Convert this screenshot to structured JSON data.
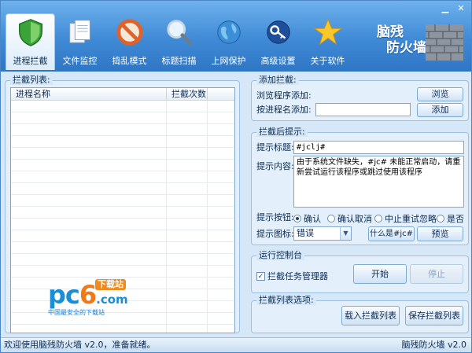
{
  "toolbar": {
    "items": [
      {
        "label": "进程拦截",
        "icon": "shield-icon",
        "active": true
      },
      {
        "label": "文件监控",
        "icon": "documents-icon",
        "active": false
      },
      {
        "label": "捣乱模式",
        "icon": "forbidden-icon",
        "active": false
      },
      {
        "label": "标题扫描",
        "icon": "magnifier-icon",
        "active": false
      },
      {
        "label": "上网保护",
        "icon": "globe-icon",
        "active": false
      },
      {
        "label": "高级设置",
        "icon": "key-icon",
        "active": false
      },
      {
        "label": "关于软件",
        "icon": "star-icon",
        "active": false
      }
    ]
  },
  "brand": {
    "line1": "脑残",
    "line2": "防火墙"
  },
  "intercept_list": {
    "title": "拦截列表:",
    "columns": [
      "进程名称",
      "拦截次数"
    ],
    "rows": []
  },
  "watermark": {
    "name_pc": "pc",
    "name_6": "6",
    "domain": ".com",
    "badge": "下载站",
    "slogan": "中国最安全的下载站"
  },
  "add_intercept": {
    "title": "添加拦截:",
    "browse_label": "浏览程序添加:",
    "browse_button": "浏览",
    "by_name_label": "按进程名添加:",
    "by_name_value": "",
    "add_button": "添加"
  },
  "prompt": {
    "title": "拦截后提示:",
    "title_label": "提示标题:",
    "title_value": "#jclj#",
    "content_label": "提示内容:",
    "content_value": "由于系统文件缺失，#jc# 未能正常启动，请重新尝试运行该程序或跳过使用该程序",
    "buttons_label": "提示按钮:",
    "button_options": [
      {
        "label": "确认",
        "selected": true
      },
      {
        "label": "确认取消",
        "selected": false
      },
      {
        "label": "中止重试忽略",
        "selected": false
      },
      {
        "label": "是否",
        "selected": false
      }
    ],
    "icon_label": "提示图标:",
    "icon_value": "错误",
    "whatis_button": "什么是#jc#",
    "preview_button": "预览"
  },
  "console": {
    "title": "运行控制台",
    "checkbox_label": "拦截任务管理器",
    "checkbox_checked": true,
    "start_button": "开始",
    "stop_button": "停止"
  },
  "list_options": {
    "title": "拦截列表选项:",
    "load_button": "载入拦截列表",
    "save_button": "保存拦截列表"
  },
  "status": {
    "left": "欢迎使用脑残防火墙 v2.0，准备就绪。",
    "right": "脑残防火墙 v2.0"
  },
  "colors": {
    "header": "#3f8ad6",
    "accent": "#1a8fd6",
    "panel": "#d6e8f8"
  }
}
